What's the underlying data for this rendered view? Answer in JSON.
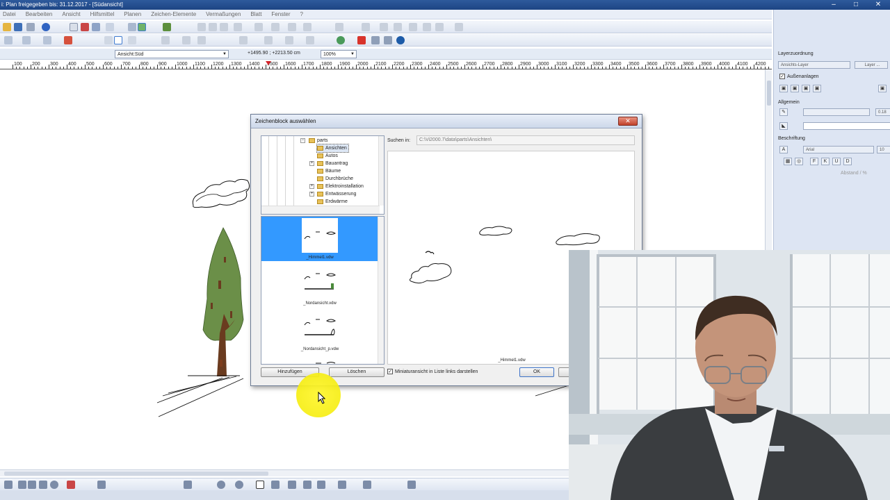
{
  "window": {
    "title": "i: Plan freigegeben bis: 31.12.2017 - [Südansicht]",
    "controls": [
      "–",
      "□",
      "✕"
    ]
  },
  "menu": [
    "Datei",
    "Bearbeiten",
    "Ansicht",
    "Hilfsmittel",
    "Planen",
    "Zeichen-Elemente",
    "Vermaßungen",
    "Blatt",
    "Fenster",
    "?"
  ],
  "options_bar": {
    "view_select": "Ansicht:Süd",
    "coordinates": "+1495.90 ; +2213.50 cm",
    "zoom": "100%"
  },
  "ruler": {
    "ticks": [
      "100",
      "200",
      "300",
      "400",
      "500",
      "600",
      "700",
      "800",
      "900",
      "1000",
      "1100",
      "1200",
      "1300",
      "1400",
      "1500",
      "1600",
      "1700",
      "1800",
      "1900",
      "2000",
      "2100",
      "2200",
      "2300",
      "2400",
      "2500",
      "2600",
      "2700",
      "2800",
      "2900",
      "3000",
      "3100",
      "3200",
      "3300",
      "3400",
      "3500",
      "3600",
      "3700",
      "3800",
      "3900",
      "4000",
      "4100",
      "4200"
    ]
  },
  "right_panel": {
    "title": "Layerzuordnung",
    "layer_select": "Ansichts-Layer",
    "layer_button": "Layer ...",
    "checkbox_label": "Außenanlagen",
    "section_general": "Allgemein",
    "pen_value": "0.18",
    "section_label": "Beschriftung",
    "font_select": "Arial",
    "font_size": "10",
    "font_buttons": [
      "F",
      "K",
      "U",
      "D"
    ],
    "spacing_label": "Abstand / %"
  },
  "dialog": {
    "title": "Zeichenblock auswählen",
    "close": "✕",
    "tree": [
      {
        "label": "parts",
        "level": 0,
        "expanded": true
      },
      {
        "label": "Ansichten",
        "level": 1,
        "selected": true
      },
      {
        "label": "Autos",
        "level": 1
      },
      {
        "label": "Bauantrag",
        "level": 1,
        "expandable": true
      },
      {
        "label": "Bäume",
        "level": 1
      },
      {
        "label": "Durchbrüche",
        "level": 1
      },
      {
        "label": "Elektroinstallation",
        "level": 1,
        "expandable": true
      },
      {
        "label": "Entwässerung",
        "level": 1,
        "expandable": true
      },
      {
        "label": "Erdwärme",
        "level": 1
      }
    ],
    "thumbnails": [
      {
        "caption": "_Himmel1.vdw",
        "selected": true
      },
      {
        "caption": "_Nordansicht.vdw"
      },
      {
        "caption": "_Nordansicht_p.vdw"
      }
    ],
    "search_label": "Suchen in:",
    "search_path": "C:\\Vi2000.7\\data\\parts\\Ansichten\\",
    "preview_caption": "_Himmel1.vdw",
    "add_button": "Hinzufügen",
    "delete_button": "Löschen",
    "thumbnail_checkbox_label": "Miniaturansicht in Liste links darstellen",
    "thumbnail_checkbox_mark": "✓",
    "ok_button": "OK",
    "cancel_button": "Ab"
  },
  "colors": {
    "titlebar": "#1d4584",
    "selection": "#3399ff",
    "tree_foliage": "#6b8f48",
    "trunk": "#6a3b1f",
    "highlight": "#f2ea0a"
  }
}
